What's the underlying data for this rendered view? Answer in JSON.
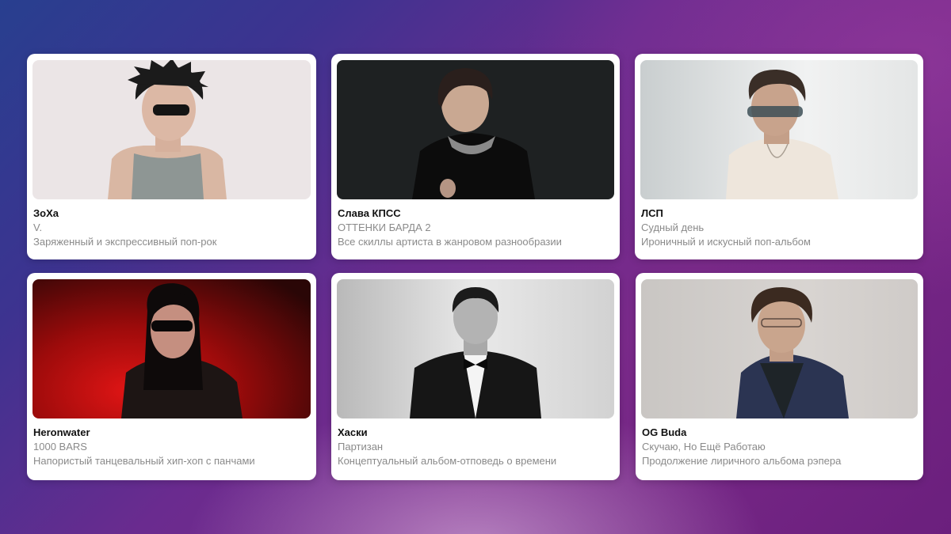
{
  "cards": [
    {
      "artist": "ЗоХа",
      "album": "V.",
      "description": "Заряженный и экспрессивный поп-рок"
    },
    {
      "artist": "Слава КПСС",
      "album": "ОТТЕНКИ БАРДА 2",
      "description": "Все скиллы артиста в жанровом разнообразии"
    },
    {
      "artist": "ЛСП",
      "album": "Судный день",
      "description": "Ироничный и искусный поп-альбом"
    },
    {
      "artist": "Heronwater",
      "album": "1000 BARS",
      "description": "Напористый танцевальный хип-хоп с панчами"
    },
    {
      "artist": "Хаски",
      "album": "Партизан",
      "description": "Концептуальный альбом-отповедь о времени"
    },
    {
      "artist": "OG Buda",
      "album": "Скучаю, Но Ещё Работаю",
      "description": "Продолжение лиричного альбома рэпера"
    }
  ]
}
